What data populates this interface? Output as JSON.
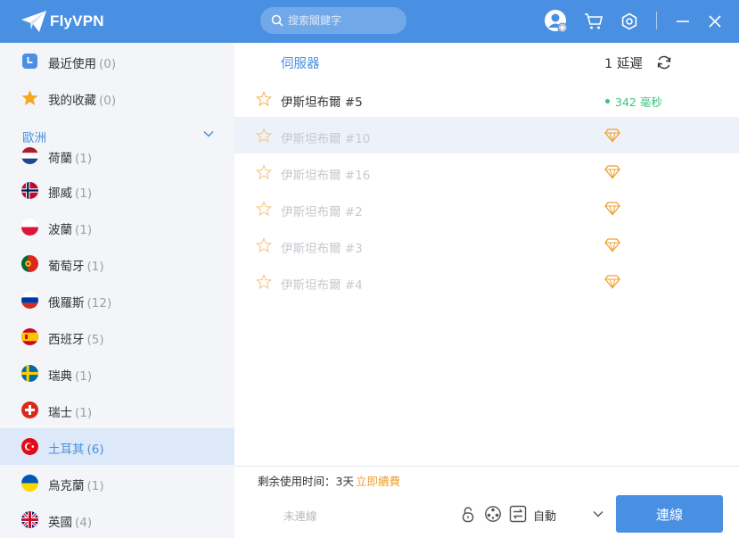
{
  "app": {
    "name": "FlyVPN"
  },
  "search": {
    "placeholder": "搜索關鍵字"
  },
  "sidebar": {
    "recent": {
      "label": "最近使用",
      "count": "(0)"
    },
    "favorites": {
      "label": "我的收藏",
      "count": "(0)"
    },
    "region": {
      "label": "歐洲"
    },
    "countries": [
      {
        "name": "荷蘭",
        "count": "(1)"
      },
      {
        "name": "挪威",
        "count": "(1)"
      },
      {
        "name": "波蘭",
        "count": "(1)"
      },
      {
        "name": "葡萄牙",
        "count": "(1)"
      },
      {
        "name": "俄羅斯",
        "count": "(12)"
      },
      {
        "name": "西班牙",
        "count": "(5)"
      },
      {
        "name": "瑞典",
        "count": "(1)"
      },
      {
        "name": "瑞士",
        "count": "(1)"
      },
      {
        "name": "土耳其",
        "count": "(6)"
      },
      {
        "name": "烏克蘭",
        "count": "(1)"
      },
      {
        "name": "英國",
        "count": "(4)"
      }
    ]
  },
  "server_list": {
    "header_server": "伺服器",
    "header_latency": "1 延遲",
    "servers": [
      {
        "name": "伊斯坦布爾 #5",
        "latency": "342 毫秒"
      },
      {
        "name": "伊斯坦布爾 #10"
      },
      {
        "name": "伊斯坦布爾 #16"
      },
      {
        "name": "伊斯坦布爾 #2"
      },
      {
        "name": "伊斯坦布爾 #3"
      },
      {
        "name": "伊斯坦布爾 #4"
      }
    ]
  },
  "bottom": {
    "remaining_label": "剩余使用时间：3天",
    "renew_label": "立即續費",
    "status": "未連線",
    "mode": "自動",
    "connect_label": "連線"
  },
  "colors": {
    "accent": "#4a90e2",
    "latency_good": "#3cc37a",
    "premium": "#f0a030",
    "selected_bg": "#dde8f8"
  }
}
